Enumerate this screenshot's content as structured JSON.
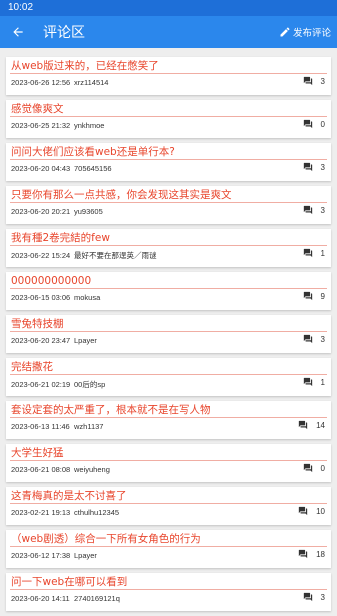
{
  "status": {
    "time": "10:02"
  },
  "appbar": {
    "title": "评论区",
    "publish_label": "发布评论"
  },
  "comments": [
    {
      "title": "从web版过来的，已经在憋笑了",
      "date": "2023-06-26 12:56",
      "user": "xrz114514",
      "replies": "3"
    },
    {
      "title": "感觉像爽文",
      "date": "2023-06-25 21:32",
      "user": "ynkhmoe",
      "replies": "0"
    },
    {
      "title": "问问大佬们应该看web还是单行本?",
      "date": "2023-06-20 04:43",
      "user": "705645156",
      "replies": "3"
    },
    {
      "title": "只要你有那么一点共感，你会发现这其实是爽文",
      "date": "2023-06-20 20:21",
      "user": "yu93605",
      "replies": "3"
    },
    {
      "title": "我有種2卷完結的few",
      "date": "2023-06-22 15:24",
      "user": "最好不要在那逞英／雨谜",
      "replies": "1"
    },
    {
      "title": "000000000000",
      "date": "2023-06-15 03:06",
      "user": "mokusa",
      "replies": "9"
    },
    {
      "title": "雪兔特技棚",
      "date": "2023-06-20 23:47",
      "user": "Lpayer",
      "replies": "3"
    },
    {
      "title": "完结撒花",
      "date": "2023-06-21 02:19",
      "user": "00后的sp",
      "replies": "1"
    },
    {
      "title": "套设定套的太严重了，根本就不是在写人物",
      "date": "2023-06-13 11:46",
      "user": "wzh1137",
      "replies": "14"
    },
    {
      "title": "大学生好猛",
      "date": "2023-06-21 08:08",
      "user": "weiyuheng",
      "replies": "0"
    },
    {
      "title": "这青梅真的是太不讨喜了",
      "date": "2023-02-21 19:13",
      "user": "cthulhu12345",
      "replies": "10"
    },
    {
      "title": "（web剧透）综合一下所有女角色的行为",
      "date": "2023-06-12 17:38",
      "user": "Lpayer",
      "replies": "18"
    },
    {
      "title": "问一下web在哪可以看到",
      "date": "2023-06-20 14:11",
      "user": "2740169121q",
      "replies": "3"
    }
  ],
  "colors": {
    "appbar": "#2b87ec",
    "statusbar": "#1e6fd8",
    "title_text": "#e8452c"
  },
  "icons": {
    "back": "arrow-left-icon",
    "publish": "pencil-icon",
    "reply": "chat-bubbles-icon"
  }
}
